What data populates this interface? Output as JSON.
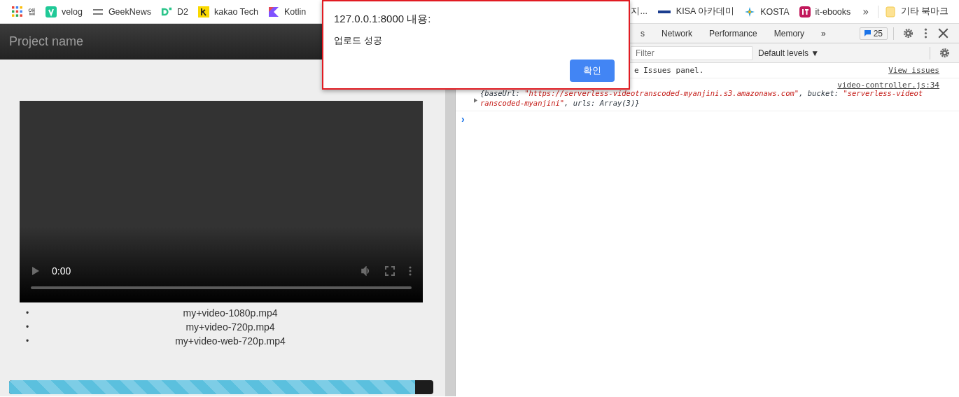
{
  "bookmarks_left": [
    {
      "kind": "apps",
      "label": "앱"
    },
    {
      "kind": "velog",
      "label": "velog"
    },
    {
      "kind": "geeknews",
      "label": "GeekNews"
    },
    {
      "kind": "d2",
      "label": "D2"
    },
    {
      "kind": "kakao",
      "label": "kakao Tech"
    },
    {
      "kind": "kotlin",
      "label": "Kotlin"
    }
  ],
  "bookmarks_right": [
    {
      "kind": "none",
      "label": "지..."
    },
    {
      "kind": "kisa",
      "label": "KISA 아카데미"
    },
    {
      "kind": "kosta",
      "label": "KOSTA"
    },
    {
      "kind": "itebooks",
      "label": "it-ebooks"
    }
  ],
  "bookmarks_more": "»",
  "other_bookmarks": "기타 북마크",
  "page": {
    "brand": "Project name",
    "video": {
      "time": "0:00"
    },
    "bullet": "•",
    "files": [
      "my+video-1080p.mp4",
      "my+video-720p.mp4",
      "my+video-web-720p.mp4"
    ],
    "progress": {
      "level": 0.957
    }
  },
  "devtools": {
    "tabs": [
      {
        "label": "s",
        "selected": false
      },
      {
        "label": "Network",
        "selected": false
      },
      {
        "label": "Performance",
        "selected": false
      },
      {
        "label": "Memory",
        "selected": false
      }
    ],
    "tabs_more": "»",
    "issues_count": "25",
    "filter": {
      "placeholder": "Filter"
    },
    "levels": "Default levels ▼",
    "issues_note": "e Issues panel.",
    "view_issues": "View issues",
    "log": {
      "source": "video-controller.js:34",
      "lines": [
        [
          {
            "t": "{baseUrl: ",
            "kind": "key"
          },
          {
            "t": "\"https://serverless-videotranscoded-myanjini.s3.amazonaws.com\"",
            "kind": "str"
          },
          {
            "t": ", bucket: ",
            "kind": "key"
          },
          {
            "t": "\"serverless-videot",
            "kind": "str"
          }
        ],
        [
          {
            "t": "ranscoded-myanjini\"",
            "kind": "str"
          },
          {
            "t": ", urls: Array(3)}",
            "kind": "key"
          }
        ]
      ]
    },
    "prompt": "›"
  },
  "dialog": {
    "title": "127.0.0.1:8000 내용:",
    "message": "업로드 성공",
    "ok": "확인"
  }
}
